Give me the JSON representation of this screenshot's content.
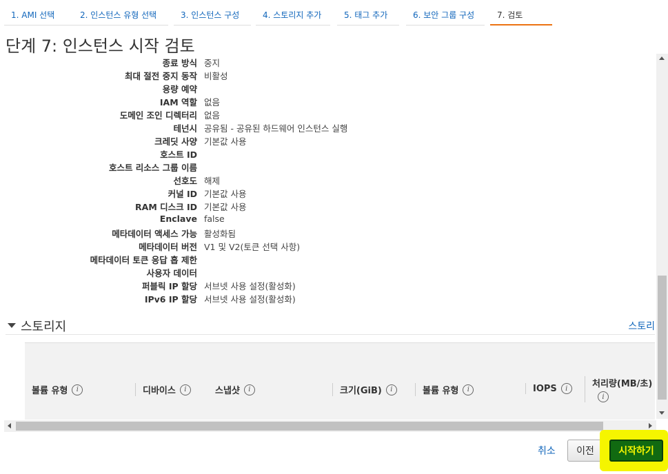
{
  "tabs": [
    {
      "label": "1. AMI 선택"
    },
    {
      "label": "2. 인스턴스 유형 선택"
    },
    {
      "label": "3. 인스턴스 구성"
    },
    {
      "label": "4. 스토리지 추가"
    },
    {
      "label": "5. 태그 추가"
    },
    {
      "label": "6. 보안 그룹 구성"
    },
    {
      "label": "7. 검토"
    }
  ],
  "page_title": "단계 7: 인스턴스 시작 검토",
  "details": [
    {
      "label": "종료 방식",
      "value": "중지"
    },
    {
      "label": "최대 절전 중지 동작",
      "value": "비활성"
    },
    {
      "label": "용량 예약",
      "value": ""
    },
    {
      "label": "IAM 역할",
      "value": "없음"
    },
    {
      "label": "도메인 조인 디렉터리",
      "value": "없음"
    },
    {
      "label": "테넌시",
      "value": "공유됨 - 공유된 하드웨어 인스턴스 실행"
    },
    {
      "label": "크레딧 사양",
      "value": "기본값 사용"
    },
    {
      "label": "호스트 ID",
      "value": ""
    },
    {
      "label": "호스트 리소스 그룹 이름",
      "value": ""
    },
    {
      "label": "선호도",
      "value": "해제"
    },
    {
      "label": "커널 ID",
      "value": "기본값 사용"
    },
    {
      "label": "RAM 디스크 ID",
      "value": "기본값 사용"
    },
    {
      "label": "Enclave",
      "value": "false"
    },
    {
      "label": "메타데이터 액세스 가능",
      "value": "활성화됨"
    },
    {
      "label": "메타데이터 버전",
      "value": "V1 및 V2(토큰 선택 사항)"
    },
    {
      "label": "메타데이터 토큰 응답 홉 제한",
      "value": ""
    },
    {
      "label": "사용자 데이터",
      "value": ""
    },
    {
      "label": "퍼블릭 IP 할당",
      "value": "서브넷 사용 설정(활성화)"
    },
    {
      "label": "IPv6 IP 할당",
      "value": "서브넷 사용 설정(활성화)"
    }
  ],
  "storage": {
    "title": "스토리지",
    "edit_link": "스토리",
    "columns": [
      {
        "label": "볼륨 유형"
      },
      {
        "label": "디바이스"
      },
      {
        "label": "스냅샷"
      },
      {
        "label": "크기(GiB)"
      },
      {
        "label": "볼륨 유형"
      },
      {
        "label": "IOPS"
      },
      {
        "label": "처리량(MB/초)"
      }
    ]
  },
  "footer": {
    "cancel_label": "취소",
    "prev_label": "이전",
    "launch_label": "시작하기"
  },
  "info_glyph": "i"
}
